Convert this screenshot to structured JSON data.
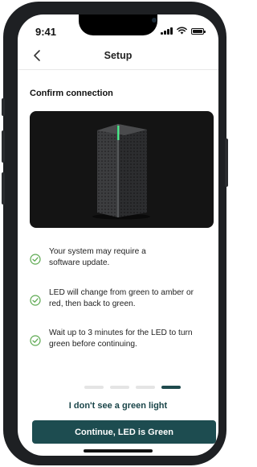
{
  "status_bar": {
    "time": "9:41"
  },
  "nav": {
    "title": "Setup"
  },
  "section": {
    "title": "Confirm connection"
  },
  "checklist": [
    {
      "text": "Your system may require a software update."
    },
    {
      "text": "LED will change from green to amber or red, then back to green."
    },
    {
      "text": "Wait up to 3 minutes for the LED to turn green before continuing."
    }
  ],
  "pager": {
    "total": 4,
    "current": 4
  },
  "link_label": "I don't see a green light",
  "primary_button_label": "Continue, LED is Green",
  "colors": {
    "accent": "#1d4c50",
    "check": "#5aa84e",
    "led": "#35e07a"
  }
}
